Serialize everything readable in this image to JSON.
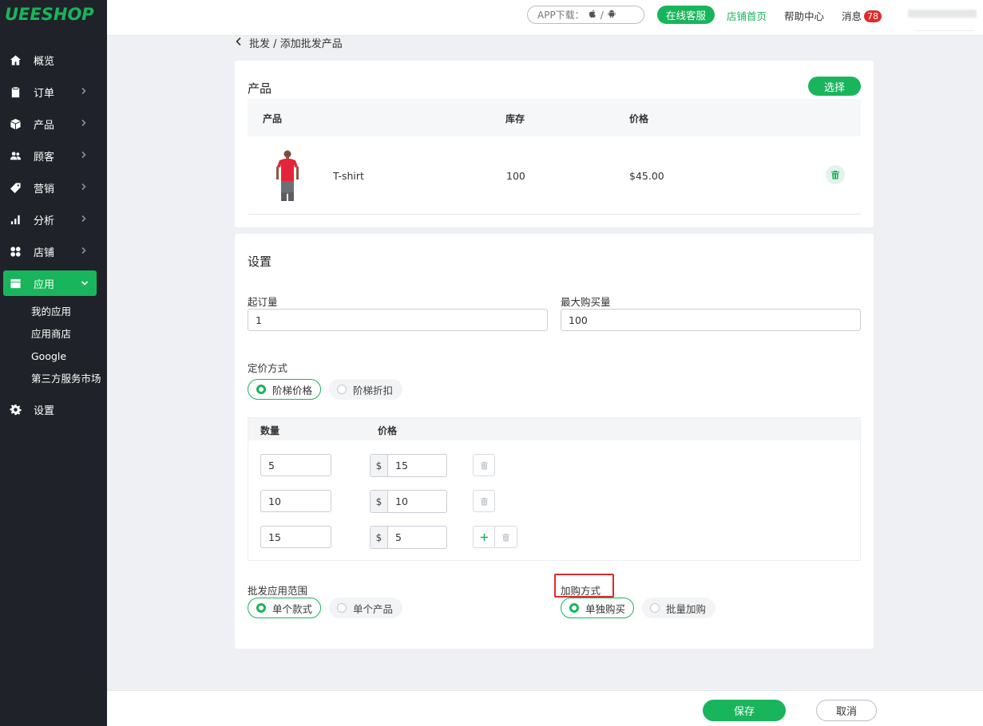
{
  "brand": {
    "logo_text": "UEESHOP",
    "accent": "#19b55c",
    "sidebar_bg": "#1f2329"
  },
  "sidebar": {
    "items": [
      {
        "label": "概览",
        "icon": "home-icon",
        "has_children": false
      },
      {
        "label": "订单",
        "icon": "clipboard-icon",
        "has_children": true
      },
      {
        "label": "产品",
        "icon": "box-icon",
        "has_children": true
      },
      {
        "label": "顾客",
        "icon": "users-icon",
        "has_children": true
      },
      {
        "label": "营销",
        "icon": "tag-icon",
        "has_children": true
      },
      {
        "label": "分析",
        "icon": "bar-chart-icon",
        "has_children": true
      },
      {
        "label": "店铺",
        "icon": "grid-icon",
        "has_children": true
      },
      {
        "label": "应用",
        "icon": "apps-icon",
        "has_children": true,
        "active": true
      },
      {
        "label": "设置",
        "icon": "gear-icon",
        "has_children": false
      }
    ],
    "apps_children": [
      "我的应用",
      "应用商店",
      "Google",
      "第三方服务市场"
    ]
  },
  "topbar": {
    "app_download": "APP下载：",
    "app_sep": "/",
    "online_service": "在线客服",
    "store_home": "店铺首页",
    "help_center": "帮助中心",
    "messages": "消息",
    "messages_count": "78"
  },
  "breadcrumb": {
    "parent": "批发",
    "sep": "/",
    "current": "添加批发产品"
  },
  "product_card": {
    "title": "产品",
    "select_button": "选择",
    "columns": [
      "产品",
      "库存",
      "价格"
    ],
    "rows": [
      {
        "name": "T-shirt",
        "stock": "100",
        "price": "$45.00"
      }
    ]
  },
  "settings_card": {
    "title": "设置",
    "min_order": {
      "label": "起订量",
      "value": "1"
    },
    "max_order": {
      "label": "最大购买量",
      "value": "100"
    },
    "pricing_method": {
      "label": "定价方式",
      "options": [
        "阶梯价格",
        "阶梯折扣"
      ],
      "selected": 0
    },
    "tiers": {
      "columns": [
        "数量",
        "价格"
      ],
      "currency_symbol": "$",
      "rows": [
        {
          "qty": "5",
          "price": "15"
        },
        {
          "qty": "10",
          "price": "10"
        },
        {
          "qty": "15",
          "price": "5"
        }
      ]
    },
    "scope": {
      "label": "批发应用范围",
      "options": [
        "单个款式",
        "单个产品"
      ],
      "selected": 0
    },
    "purchase_mode": {
      "label": "加购方式",
      "options": [
        "单独购买",
        "批量加购"
      ],
      "selected": 0
    }
  },
  "footer": {
    "save": "保存",
    "cancel": "取消"
  }
}
